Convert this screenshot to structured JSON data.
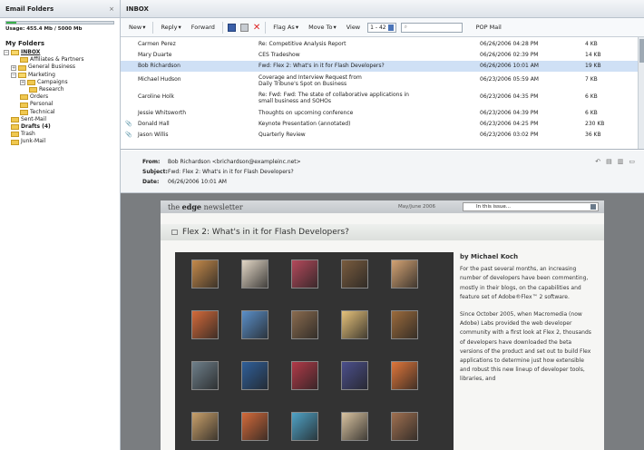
{
  "left_panel": {
    "title": "Email Folders",
    "close": "×",
    "usage_fraction": 0.09,
    "usage_text": "Usage: 455.4 Mb / 5000 Mb",
    "my_folders": "My Folders",
    "tree": [
      {
        "label": "INBOX",
        "exp": "−"
      },
      {
        "label": "Affiliates & Partners"
      },
      {
        "label": "General Business",
        "exp": "+"
      },
      {
        "label": "Marketing",
        "exp": "−"
      },
      {
        "label": "Campaigns",
        "exp": "+"
      },
      {
        "label": "Research"
      },
      {
        "label": "Orders"
      },
      {
        "label": "Personal"
      },
      {
        "label": "Technical"
      },
      {
        "label": "Sent-Mail"
      },
      {
        "label": "Drafts (4)"
      },
      {
        "label": "Trash"
      },
      {
        "label": "Junk-Mail"
      }
    ]
  },
  "inbox": {
    "title": "INBOX",
    "toolbar": {
      "new": "New",
      "reply": "Reply",
      "forward": "Forward",
      "flag_as": "Flag As",
      "move_to": "Move To",
      "view": "View",
      "page_range": "1 - 42",
      "pop_mail": "POP Mail"
    },
    "messages": [
      {
        "from": "Carmen Perez",
        "subject": "Re: Competitive Analysis Report",
        "date": "06/26/2006 04:28 PM",
        "size": "4 KB"
      },
      {
        "from": "Mary Duarte",
        "subject": "CES Tradeshow",
        "date": "06/26/2006 02:39 PM",
        "size": "14 KB"
      },
      {
        "from": "Bob Richardson",
        "subject": "Fwd: Flex 2: What's in it for Flash Developers?",
        "date": "06/26/2006 10:01 AM",
        "size": "19 KB",
        "selected": true
      },
      {
        "from": "Michael Hudson",
        "subject": "Coverage and Interview Request from",
        "subject2": "Daily Tribune's Spot on Business",
        "date": "06/23/2006 05:59 AM",
        "size": "7 KB"
      },
      {
        "from": "Caroline Holk",
        "subject": "Re: Fwd: Fwd: The state of collaborative applications in",
        "subject2": "small business and SOHOs",
        "date": "06/23/2006 04:35 PM",
        "size": "6 KB"
      },
      {
        "from": "Jessie Whitsworth",
        "subject": "Thoughts on upcoming conference",
        "date": "06/23/2006 04:39 PM",
        "size": "6 KB"
      },
      {
        "from": "Donald Hall",
        "subject": "Keynote Presentation (annotated)",
        "date": "06/23/2006 04:25 PM",
        "size": "230 KB",
        "attach": true
      },
      {
        "from": "Jason Willis",
        "subject": "Quarterly Review",
        "date": "06/23/2006 03:02 PM",
        "size": "36 KB",
        "attach": true
      }
    ]
  },
  "preview": {
    "from_label": "From:",
    "from": "Bob Richardson <brichardson@exampleinc.net>",
    "subject_label": "Subject:",
    "subject": "Fwd: Flex 2: What's in it for Flash Developers?",
    "date_label": "Date:",
    "date": "06/26/2006 10:01 AM"
  },
  "newsletter": {
    "brand_the": "the",
    "brand_edge": "edge",
    "brand_rest": "newsletter",
    "date": "May/June 2006",
    "select": "In this issue...",
    "title": "Flex 2: What's in it for Flash Developers?",
    "byline": "by Michael Koch",
    "para1": "For the past several months, an increasing number of developers have been commenting, mostly in their blogs, on the capabilities and feature set of Adobe®Flex™ 2 software.",
    "para2": "Since October 2005, when Macromedia (now Adobe) Labs provided the web developer community with a first look at Flex 2, thousands of developers have downloaded the beta versions of the product and set out to build Flex applications to determine just how extensible and robust this new lineup of developer tools, libraries, and"
  },
  "colors": {
    "selected_row": "#cfe0f5",
    "usage_bar": "#3bb04a",
    "folder": "#f0c850"
  }
}
